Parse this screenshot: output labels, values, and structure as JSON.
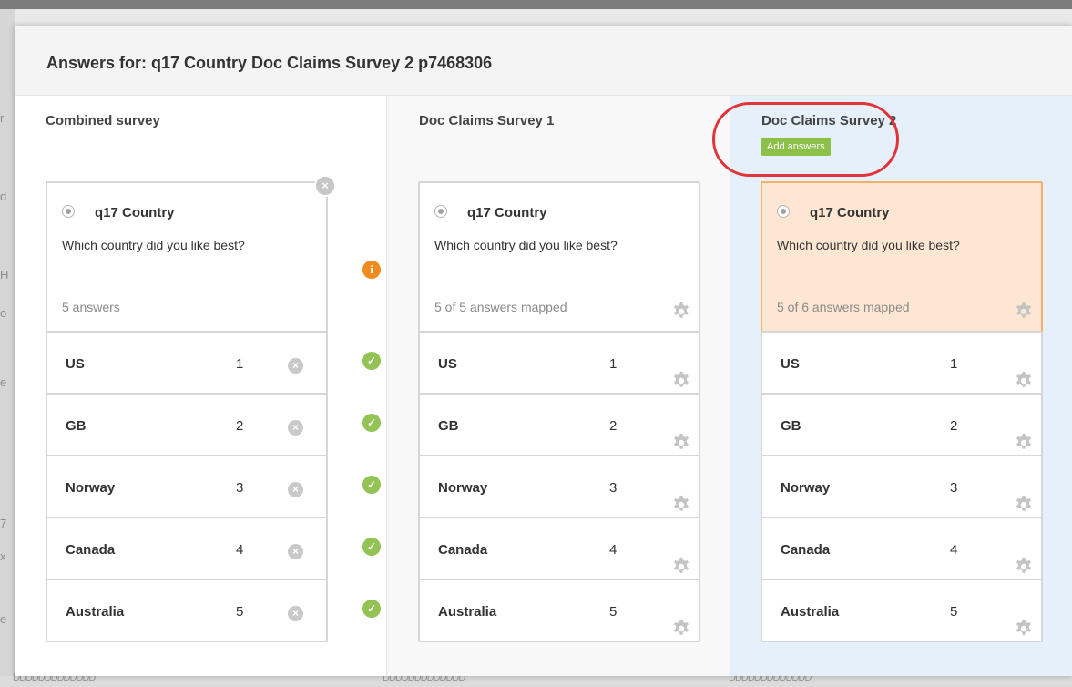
{
  "background": {
    "left_fragments": [
      "r",
      "d",
      "H",
      "o",
      "e",
      "7",
      "x",
      "e"
    ],
    "bottom_fragments": [
      "DDDDDDDDDDDDD",
      "DDDDDDDDDDDDD",
      "DDDDDDDDDDDDD"
    ]
  },
  "modal": {
    "title": "Answers for: q17 Country Doc Claims Survey 2 p7468306"
  },
  "columns": [
    {
      "title": "Combined survey",
      "question": {
        "name": "q17 Country",
        "text": "Which country did you like best?",
        "count": "5 answers"
      },
      "answers": [
        {
          "label": "US",
          "num": "1"
        },
        {
          "label": "GB",
          "num": "2"
        },
        {
          "label": "Norway",
          "num": "3"
        },
        {
          "label": "Canada",
          "num": "4"
        },
        {
          "label": "Australia",
          "num": "5"
        }
      ]
    },
    {
      "title": "Doc Claims Survey 1",
      "question": {
        "name": "q17 Country",
        "text": "Which country did you like best?",
        "count": "5 of 5 answers mapped"
      },
      "answers": [
        {
          "label": "US",
          "num": "1"
        },
        {
          "label": "GB",
          "num": "2"
        },
        {
          "label": "Norway",
          "num": "3"
        },
        {
          "label": "Canada",
          "num": "4"
        },
        {
          "label": "Australia",
          "num": "5"
        }
      ]
    },
    {
      "title": "Doc Claims Survey 2",
      "add_answers_label": "Add answers",
      "question": {
        "name": "q17 Country",
        "text": "Which country did you like best?",
        "count": "5 of 6 answers mapped"
      },
      "answers": [
        {
          "label": "US",
          "num": "1"
        },
        {
          "label": "GB",
          "num": "2"
        },
        {
          "label": "Norway",
          "num": "3"
        },
        {
          "label": "Canada",
          "num": "4"
        },
        {
          "label": "Australia",
          "num": "5"
        }
      ]
    }
  ],
  "icons": {
    "close": "×",
    "remove": "×",
    "check": "✓",
    "info": "i",
    "settings": "gear-icon"
  },
  "colors": {
    "add_answers_bg": "#8cc04b",
    "check": "#93c255",
    "info": "#f08c1f",
    "highlight_bg": "#fde7d2",
    "highlight_border": "#f5b06a",
    "annotation": "#e0343a",
    "survey2_bg": "#e6f0fb"
  }
}
